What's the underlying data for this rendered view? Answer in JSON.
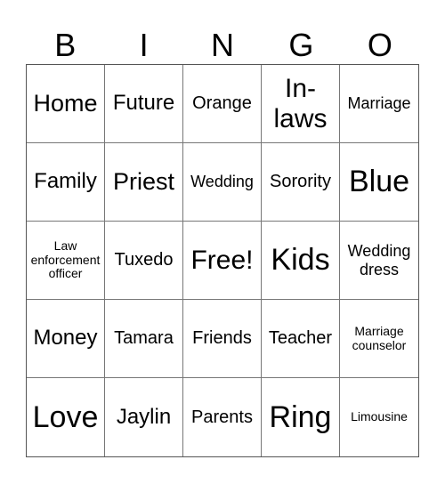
{
  "header": [
    "B",
    "I",
    "N",
    "G",
    "O"
  ],
  "cells": [
    "Home",
    "Future",
    "Orange",
    "In-laws",
    "Marriage",
    "Family",
    "Priest",
    "Wedding",
    "Sorority",
    "Blue",
    "Law enforcement officer",
    "Tuxedo",
    "Free!",
    "Kids",
    "Wedding dress",
    "Money",
    "Tamara",
    "Friends",
    "Teacher",
    "Marriage counselor",
    "Love",
    "Jaylin",
    "Parents",
    "Ring",
    "Limousine"
  ]
}
